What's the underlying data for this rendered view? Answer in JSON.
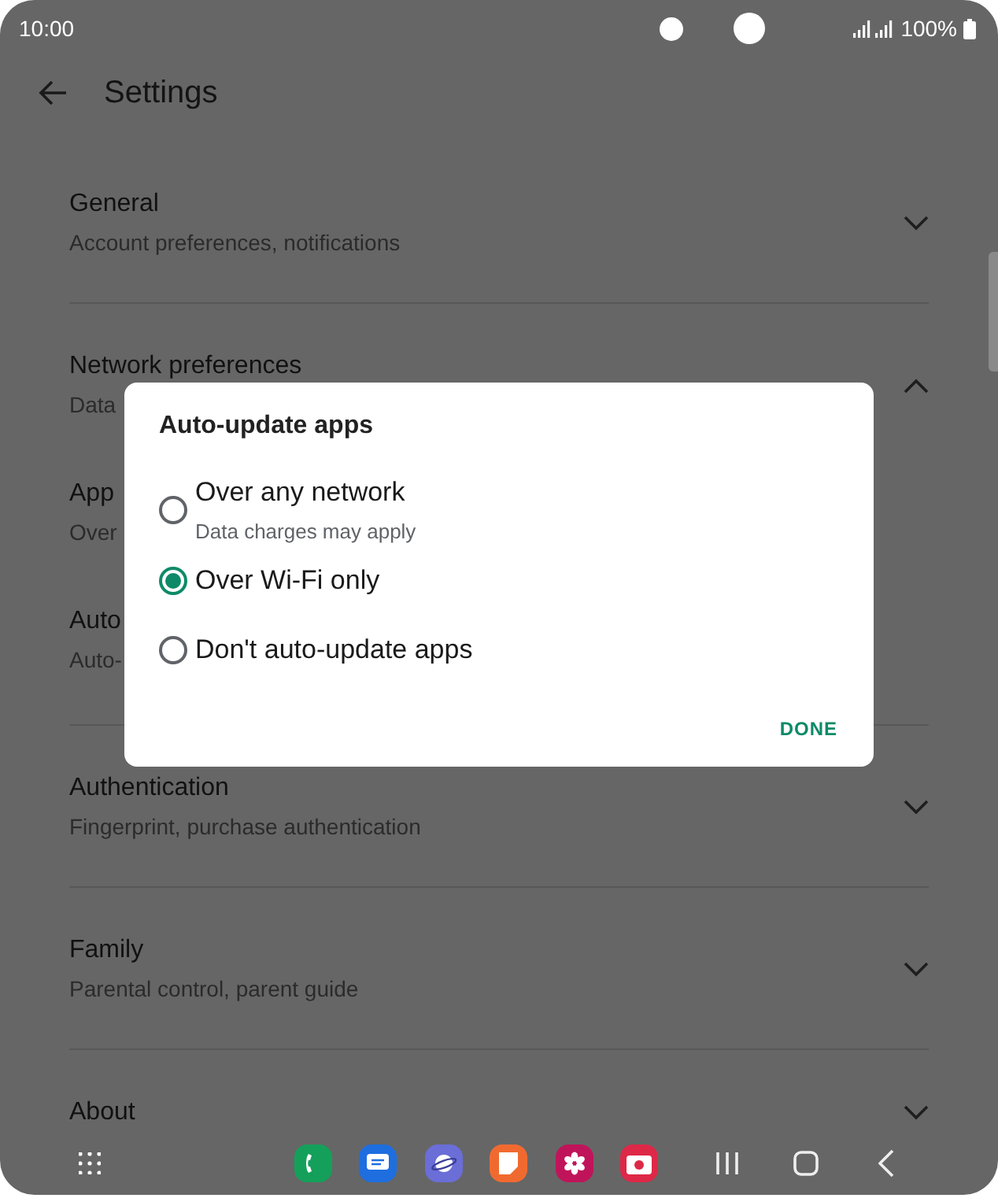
{
  "status_bar": {
    "time": "10:00",
    "battery": "100%"
  },
  "header": {
    "title": "Settings"
  },
  "sections": [
    {
      "title": "General",
      "subtitle": "Account preferences, notifications",
      "expanded": false
    },
    {
      "title": "Network preferences",
      "subtitle": "Data",
      "expanded": true,
      "children": [
        {
          "title": "App",
          "subtitle": "Over"
        },
        {
          "title": "Auto",
          "subtitle": "Auto-"
        }
      ]
    },
    {
      "title": "Authentication",
      "subtitle": "Fingerprint, purchase authentication",
      "expanded": false
    },
    {
      "title": "Family",
      "subtitle": "Parental control, parent guide",
      "expanded": false
    },
    {
      "title": "About",
      "expanded": false
    }
  ],
  "dialog": {
    "title": "Auto-update apps",
    "options": [
      {
        "label": "Over any network",
        "description": "Data charges may apply",
        "selected": false
      },
      {
        "label": "Over Wi-Fi only",
        "selected": true
      },
      {
        "label": "Don't auto-update apps",
        "selected": false
      }
    ],
    "button": "DONE"
  }
}
